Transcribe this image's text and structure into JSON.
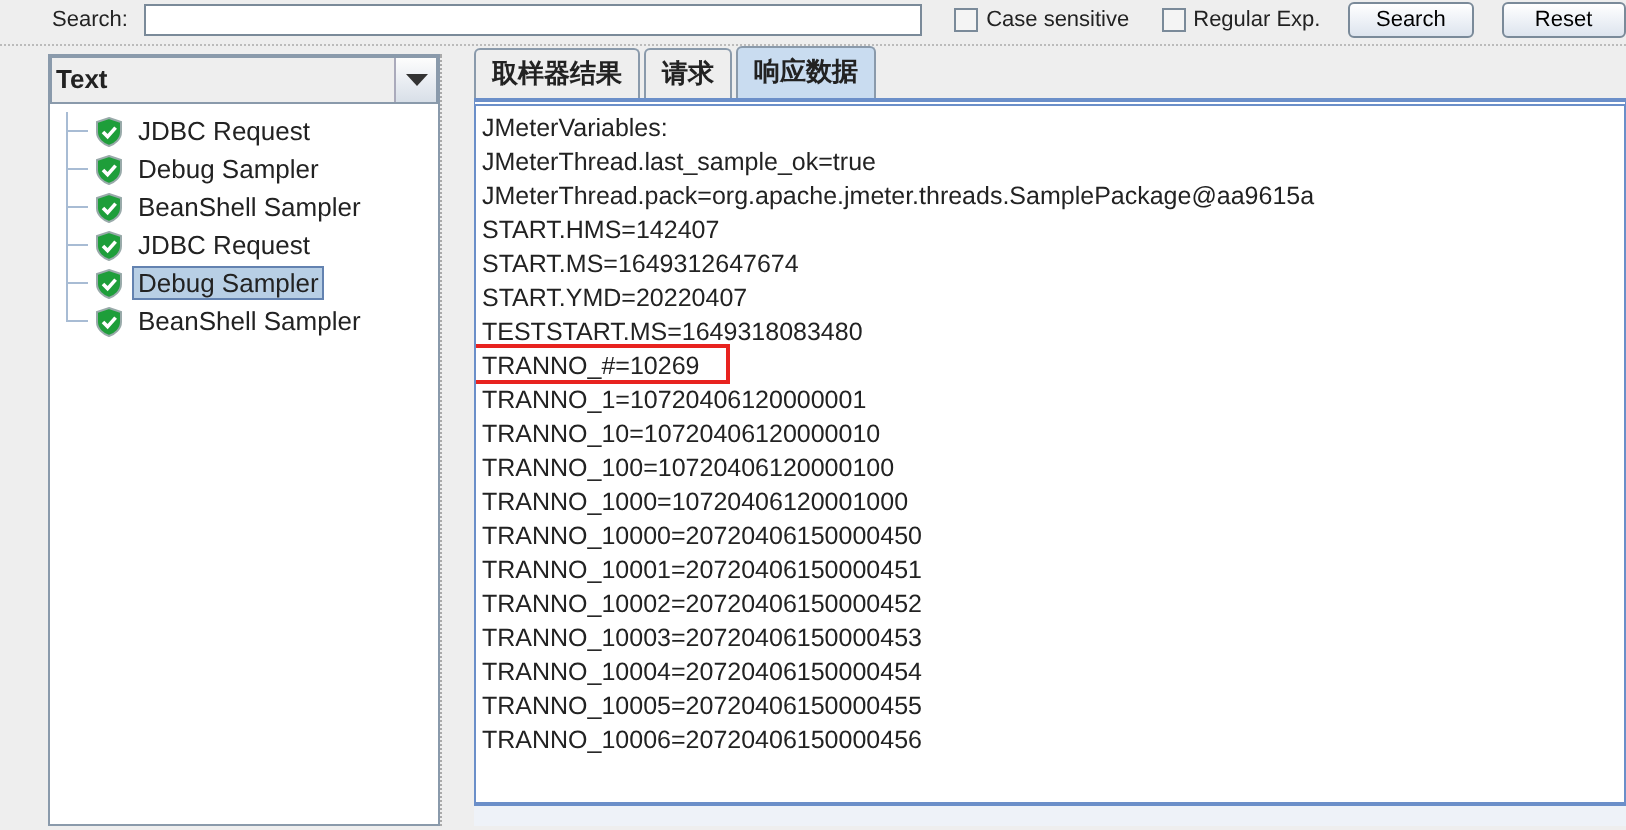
{
  "search_bar": {
    "label": "Search:",
    "options": [
      {
        "label": "Case sensitive",
        "checked": false
      },
      {
        "label": "Regular Exp.",
        "checked": false
      }
    ],
    "buttons": [
      "Search",
      "Reset"
    ]
  },
  "renderer": {
    "value": "Text"
  },
  "tree": {
    "items": [
      {
        "label": "JDBC Request",
        "selected": false
      },
      {
        "label": "Debug Sampler",
        "selected": false
      },
      {
        "label": "BeanShell Sampler",
        "selected": false
      },
      {
        "label": "JDBC Request",
        "selected": false
      },
      {
        "label": "Debug Sampler",
        "selected": true
      },
      {
        "label": "BeanShell Sampler",
        "selected": false
      }
    ]
  },
  "tabs": [
    {
      "label": "取样器结果",
      "selected": false
    },
    {
      "label": "请求",
      "selected": false
    },
    {
      "label": "响应数据",
      "selected": true
    }
  ],
  "response_lines": [
    {
      "text": "JMeterVariables:",
      "highlighted": false
    },
    {
      "text": "JMeterThread.last_sample_ok=true",
      "highlighted": false
    },
    {
      "text": "JMeterThread.pack=org.apache.jmeter.threads.SamplePackage@aa9615a",
      "highlighted": false
    },
    {
      "text": "START.HMS=142407",
      "highlighted": false
    },
    {
      "text": "START.MS=1649312647674",
      "highlighted": false
    },
    {
      "text": "START.YMD=20220407",
      "highlighted": false
    },
    {
      "text": "TESTSTART.MS=1649318083480",
      "highlighted": false
    },
    {
      "text": "TRANNO_#=10269",
      "highlighted": true
    },
    {
      "text": "TRANNO_1=10720406120000001",
      "highlighted": false
    },
    {
      "text": "TRANNO_10=10720406120000010",
      "highlighted": false
    },
    {
      "text": "TRANNO_100=10720406120000100",
      "highlighted": false
    },
    {
      "text": "TRANNO_1000=10720406120001000",
      "highlighted": false
    },
    {
      "text": "TRANNO_10000=20720406150000450",
      "highlighted": false
    },
    {
      "text": "TRANNO_10001=20720406150000451",
      "highlighted": false
    },
    {
      "text": "TRANNO_10002=20720406150000452",
      "highlighted": false
    },
    {
      "text": "TRANNO_10003=20720406150000453",
      "highlighted": false
    },
    {
      "text": "TRANNO_10004=20720406150000454",
      "highlighted": false
    },
    {
      "text": "TRANNO_10005=20720406150000455",
      "highlighted": false
    },
    {
      "text": "TRANNO_10006=20720406150000456",
      "highlighted": false
    }
  ]
}
